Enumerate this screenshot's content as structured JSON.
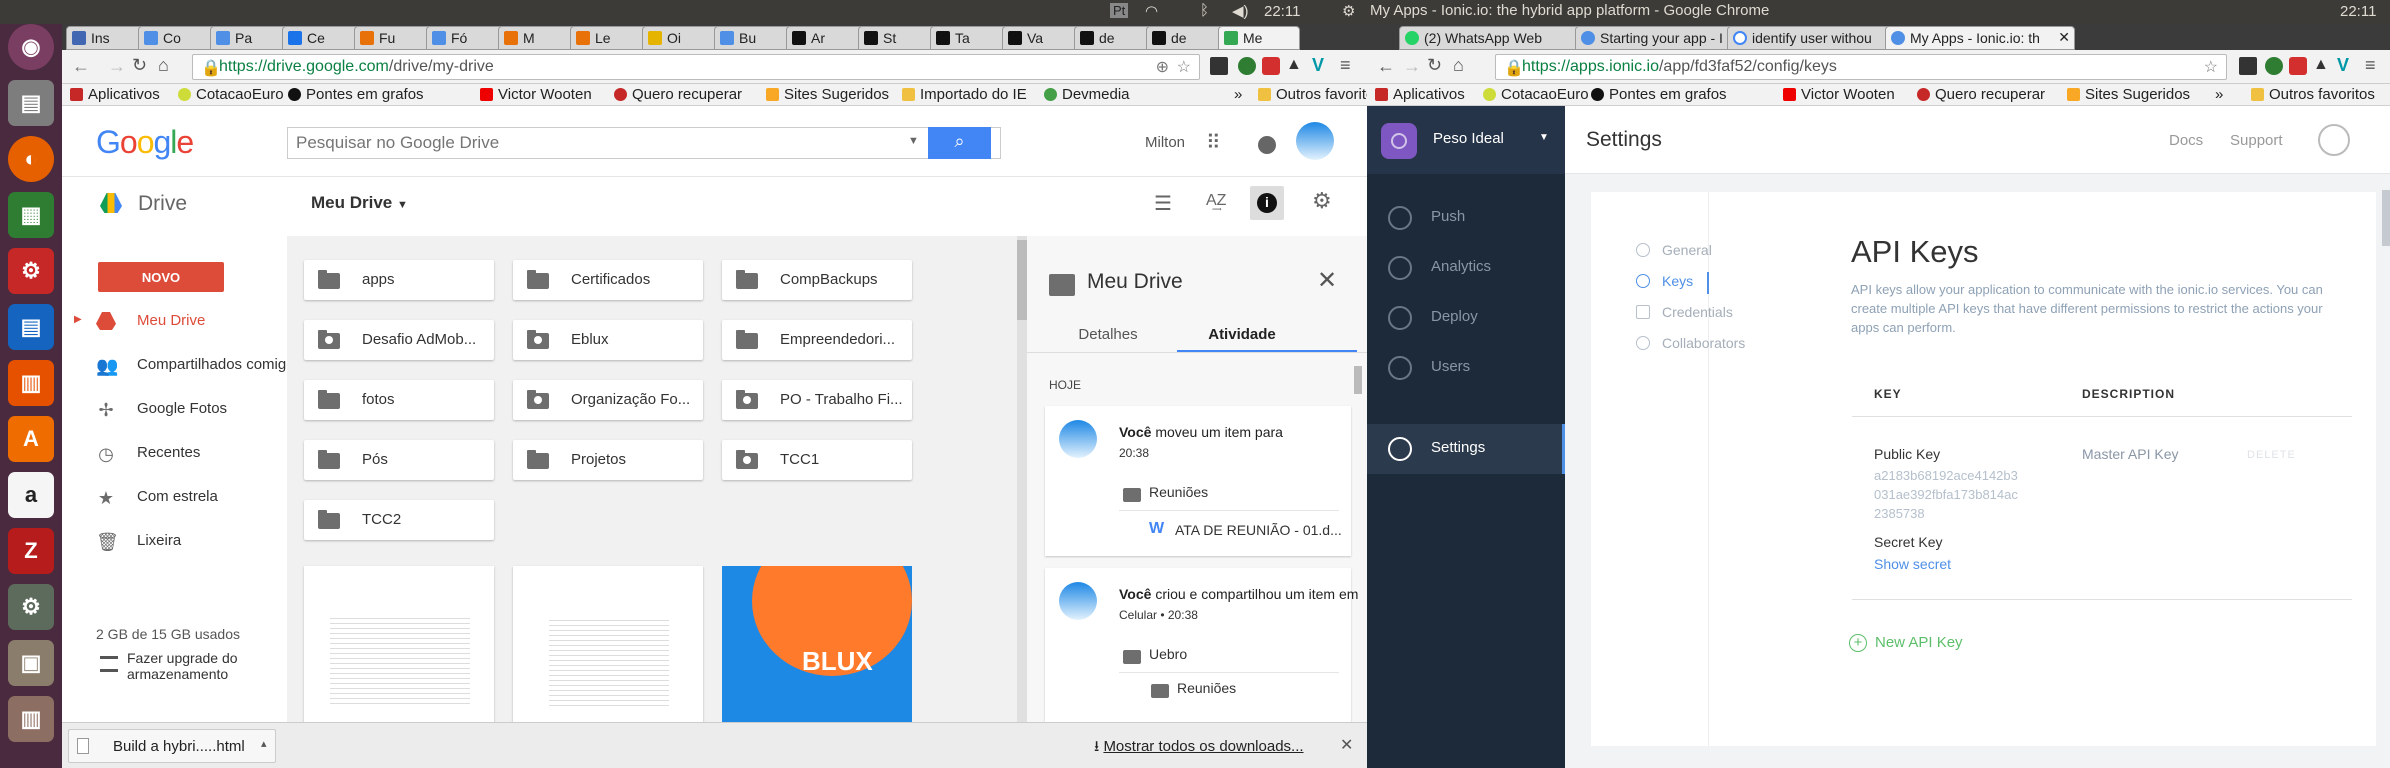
{
  "system": {
    "clock_left": "22:11",
    "title": "My Apps - Ionic.io: the hybrid app platform - Google Chrome",
    "clock_right": "22:11"
  },
  "left_browser": {
    "tabs": [
      {
        "label": "Ins",
        "color": "#4267b2"
      },
      {
        "label": "Co",
        "color": "#4f8fe6"
      },
      {
        "label": "Pa",
        "color": "#4f8fe6"
      },
      {
        "label": "Ce",
        "color": "#1a73e8"
      },
      {
        "label": "Fu",
        "color": "#e8710a"
      },
      {
        "label": "Fó",
        "color": "#4f8fe6"
      },
      {
        "label": "M",
        "color": "#e8710a"
      },
      {
        "label": "Le",
        "color": "#e8710a"
      },
      {
        "label": "Oi",
        "color": "#e5b400"
      },
      {
        "label": "Bu",
        "color": "#4f8fe6"
      },
      {
        "label": "Ar",
        "color": "#111"
      },
      {
        "label": "St",
        "color": "#111"
      },
      {
        "label": "Ta",
        "color": "#111"
      },
      {
        "label": "Va",
        "color": "#111"
      },
      {
        "label": "de",
        "color": "#111"
      },
      {
        "label": "de",
        "color": "#111"
      },
      {
        "label": "Me",
        "color": "#34a853"
      }
    ],
    "url_host": "https://drive.google.com",
    "url_path": "/drive/my-drive",
    "bookmarks": [
      "Aplicativos",
      "CotacaoEuro",
      "Pontes em grafos",
      "Victor Wooten",
      "Quero recuperar",
      "Sites Sugeridos",
      "Importado do IE",
      "Devmedia",
      "»",
      "Outros favoritos"
    ]
  },
  "right_browser": {
    "tabs": [
      "(2) WhatsApp Web",
      "Starting your app - I",
      "identify user withou",
      "My Apps - Ionic.io: th"
    ],
    "url_host": "https://apps.ionic.io",
    "url_path": "/app/fd3faf52/config/keys",
    "bookmarks": [
      "Aplicativos",
      "CotacaoEuro",
      "Pontes em grafos",
      "Victor Wooten",
      "Quero recuperar",
      "Sites Sugeridos",
      "»",
      "Outros favoritos"
    ]
  },
  "drive": {
    "logo": "Google",
    "search_placeholder": "Pesquisar no Google Drive",
    "user": "Milton",
    "app_name": "Drive",
    "location": "Meu Drive",
    "new_button": "NOVO",
    "nav": [
      "Meu Drive",
      "Compartilhados comigo",
      "Google Fotos",
      "Recentes",
      "Com estrela",
      "Lixeira"
    ],
    "storage": "2 GB de 15 GB usados",
    "upgrade": "Fazer upgrade do armazenamento",
    "folders": [
      "apps",
      "Certificados",
      "CompBackups",
      "Desafio AdMob...",
      "Eblux",
      "Empreendedori...",
      "fotos",
      "Organização Fo...",
      "PO - Trabalho Fi...",
      "Pós",
      "Projetos",
      "TCC1",
      "TCC2"
    ],
    "panel": {
      "title": "Meu Drive",
      "tab_details": "Detalhes",
      "tab_activity": "Atividade",
      "today": "HOJE",
      "a1_user": "Você",
      "a1_action": " moveu um item para",
      "a1_time": "20:38",
      "a1_folder": "Reuniões",
      "a1_file": "ATA DE REUNIÃO - 01.d...",
      "a2_user": "Você",
      "a2_action": " criou e compartilhou um item em",
      "a2_time": "Celular • 20:38",
      "a2_folder": "Uebro",
      "a2_sub": "Reuniões"
    },
    "thumb_eblux": "BLUX",
    "download_file": "Build a hybri.....html",
    "show_downloads": "Mostrar todos os downloads..."
  },
  "ionic": {
    "app_name": "Peso Ideal",
    "page": "Settings",
    "docs": "Docs",
    "support": "Support",
    "nav": [
      "Push",
      "Analytics",
      "Deploy",
      "Users",
      "Settings"
    ],
    "subnav": [
      "General",
      "Keys",
      "Credentials",
      "Collaborators"
    ],
    "heading": "API Keys",
    "description": "API keys allow your application to communicate with the ionic.io services. You can create multiple API keys that have different permissions to restrict the actions your apps can perform.",
    "col_key": "KEY",
    "col_desc": "DESCRIPTION",
    "public_key_label": "Public Key",
    "public_key_lines": [
      "a2183b68192ace4142b3",
      "031ae392fbfa173b814ac",
      "2385738"
    ],
    "public_key_desc": "Master API Key",
    "delete": "DELETE",
    "secret_label": "Secret Key",
    "show_secret": "Show secret",
    "new_key": "New API Key"
  }
}
